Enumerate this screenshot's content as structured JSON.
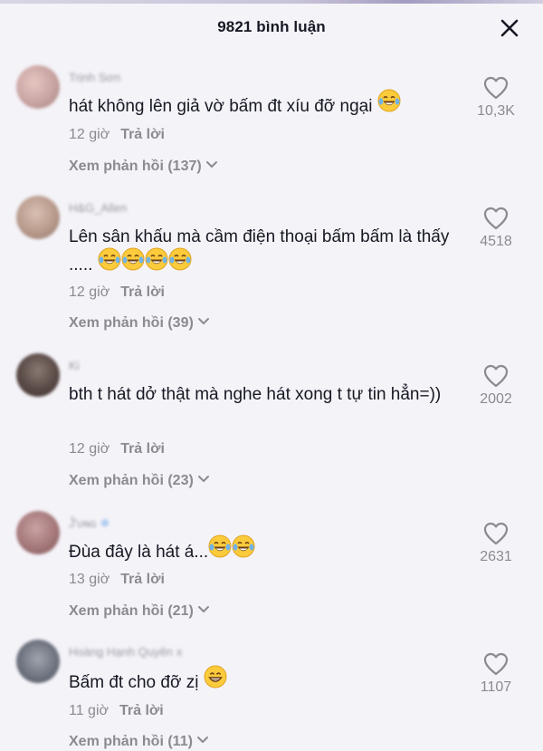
{
  "header": {
    "title": "9821 bình luận"
  },
  "comments": [
    {
      "username": "Trịnh Sơn",
      "text": "hát không lên giả vờ bấm đt xíu đỡ ngại",
      "emoji_count": 1,
      "time": "12 giờ",
      "reply_label": "Trả lời",
      "view_replies": "Xem phản hồi (137)",
      "likes": "10,3K",
      "avatar_color": "#c7a3a1"
    },
    {
      "username": "H&G_Allen",
      "text": "Lên sân khấu mà cầm điện thoại bấm bấm là thấy .....",
      "emoji_count": 4,
      "time": "12 giờ",
      "reply_label": "Trả lời",
      "view_replies": "Xem phản hồi (39)",
      "likes": "4518",
      "avatar_color": "#b89a8c"
    },
    {
      "username": "Ki",
      "text": "bth t hát dở thật mà nghe hát xong t tự tin hẳn=))",
      "emoji_count": 0,
      "time": "12 giờ",
      "reply_label": "Trả lời",
      "view_replies": "Xem phản hồi (23)",
      "likes": "2002",
      "avatar_color": "#5a4a46"
    },
    {
      "username": "Ĵ'ʋɴɢ",
      "text": "Đùa đây là hát á...",
      "emoji_count": 2,
      "time": "13 giờ",
      "reply_label": "Trả lời",
      "view_replies": "Xem phản hồi (21)",
      "likes": "2631",
      "avatar_color": "#a5787a"
    },
    {
      "username": "Hoàng Hạnh Quyên",
      "text": "Bấm đt cho đỡ zị",
      "emoji_count": 1,
      "time": "11 giờ",
      "reply_label": "Trả lời",
      "view_replies": "Xem phản hồi (11)",
      "likes": "1107",
      "avatar_color": "#6f7480"
    }
  ],
  "icons": {
    "close": "close-icon",
    "like": "heart-outline-icon",
    "chevron": "chevron-down-icon",
    "emoji_laugh": "face-with-tears-of-joy-icon",
    "emoji_grin": "grinning-face-icon"
  },
  "colors": {
    "background": "#f4f3f8",
    "text_primary": "#161823",
    "text_secondary": "#8a8b91"
  }
}
